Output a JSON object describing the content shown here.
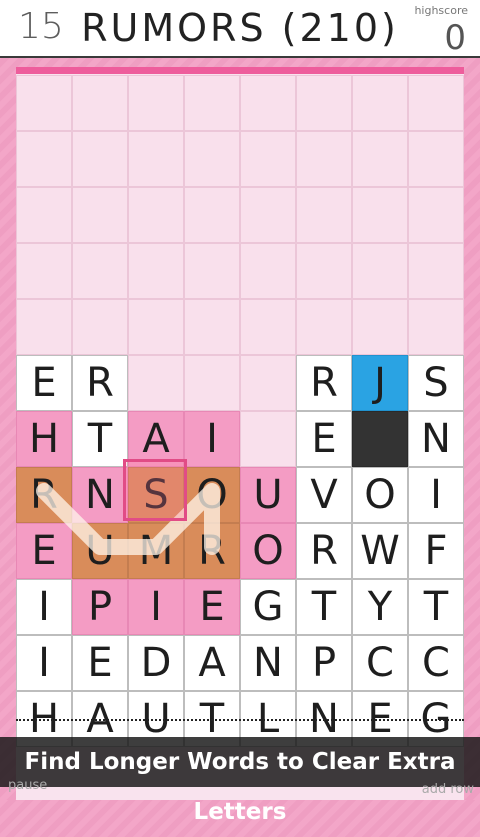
{
  "header": {
    "level": "15",
    "word_title": "RUMORS (210)",
    "highscore_label": "highscore",
    "highscore_value": "0"
  },
  "grid": [
    [
      "",
      "",
      "",
      "",
      "",
      "",
      "",
      ""
    ],
    [
      "",
      "",
      "",
      "",
      "",
      "",
      "",
      ""
    ],
    [
      "",
      "",
      "",
      "",
      "",
      "",
      "",
      ""
    ],
    [
      "",
      "",
      "",
      "",
      "",
      "",
      "",
      ""
    ],
    [
      "",
      "",
      "",
      "",
      "",
      "",
      "",
      ""
    ],
    [
      "E",
      "R",
      "",
      "",
      "",
      "R",
      "J",
      "S"
    ],
    [
      "H",
      "T",
      "A",
      "I",
      "",
      "E",
      "",
      "N"
    ],
    [
      "R",
      "N",
      "S",
      "O",
      "U",
      "V",
      "O",
      "I"
    ],
    [
      "E",
      "U",
      "M",
      "R",
      "O",
      "R",
      "W",
      "F"
    ],
    [
      "I",
      "P",
      "I",
      "E",
      "G",
      "T",
      "Y",
      "T"
    ],
    [
      "I",
      "E",
      "D",
      "A",
      "N",
      "P",
      "C",
      "C"
    ],
    [
      "H",
      "A",
      "U",
      "T",
      "L",
      "N",
      "E",
      "G"
    ]
  ],
  "cell_styles": [
    [
      "empty",
      "empty",
      "empty",
      "empty",
      "empty",
      "empty",
      "empty",
      "empty"
    ],
    [
      "empty",
      "empty",
      "empty",
      "empty",
      "empty",
      "empty",
      "empty",
      "empty"
    ],
    [
      "empty",
      "empty",
      "empty",
      "empty",
      "empty",
      "empty",
      "empty",
      "empty"
    ],
    [
      "empty",
      "empty",
      "empty",
      "empty",
      "empty",
      "empty",
      "empty",
      "empty"
    ],
    [
      "empty",
      "empty",
      "empty",
      "empty",
      "empty",
      "empty",
      "empty",
      "empty"
    ],
    [
      "white",
      "white",
      "empty",
      "empty",
      "empty",
      "white",
      "blue",
      "white"
    ],
    [
      "pink",
      "white",
      "pink",
      "pink",
      "empty",
      "white",
      "dark",
      "white"
    ],
    [
      "orange",
      "pink",
      "orange",
      "orange",
      "pink",
      "white",
      "white",
      "white"
    ],
    [
      "pink",
      "orange",
      "orange",
      "orange",
      "pink",
      "white",
      "white",
      "white"
    ],
    [
      "white",
      "pink",
      "pink",
      "pink",
      "white",
      "white",
      "white",
      "white"
    ],
    [
      "white",
      "white",
      "white",
      "white",
      "white",
      "white",
      "white",
      "white"
    ],
    [
      "white",
      "white",
      "white",
      "white",
      "white",
      "white",
      "white",
      "white"
    ]
  ],
  "tooltip": "Find Longer Words to Clear Extra Letters",
  "controls": {
    "pause": "pause",
    "add_row": "add row"
  }
}
